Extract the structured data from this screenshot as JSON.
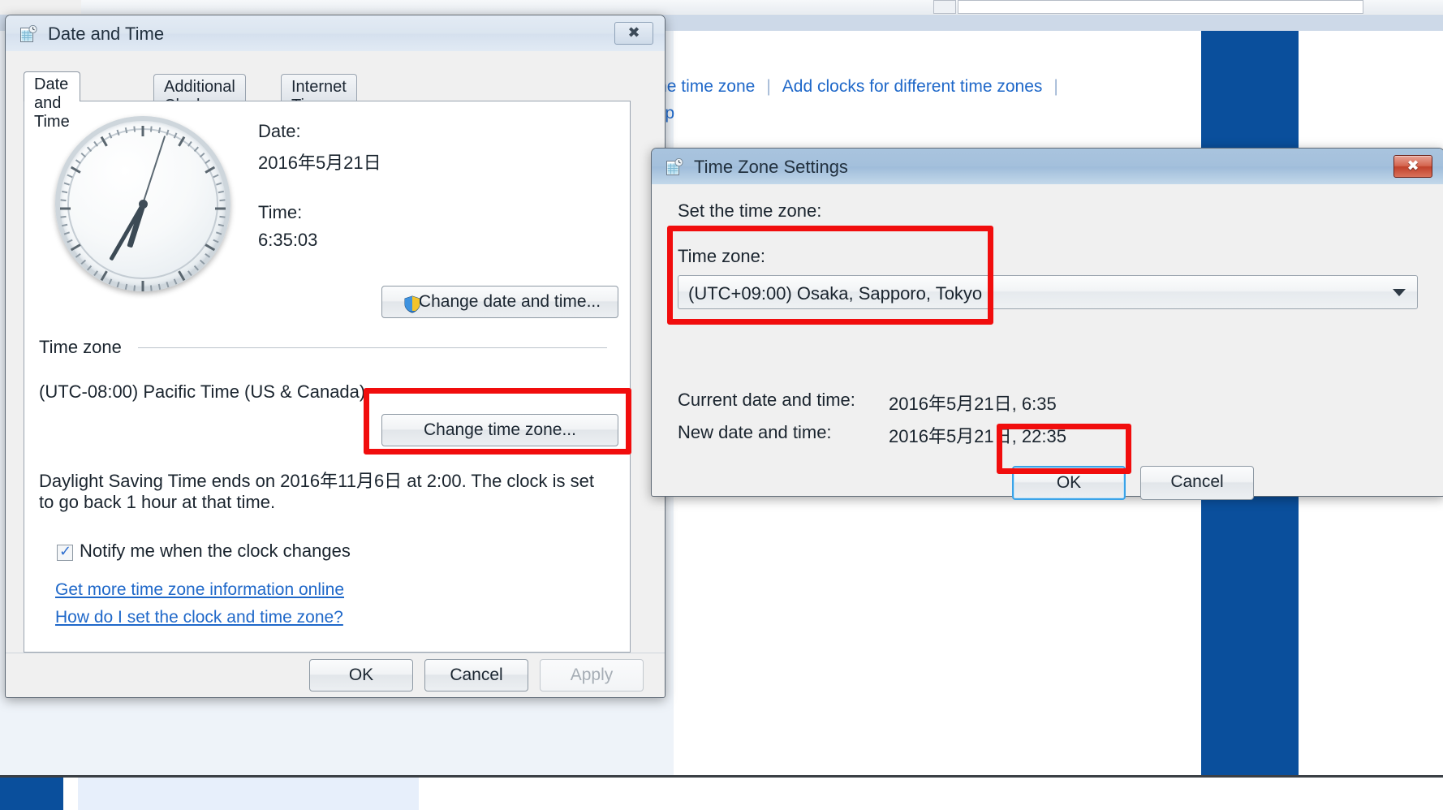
{
  "background_window": {
    "links_row1": [
      {
        "label": "hange the time zone"
      },
      {
        "label": "Add clocks for different time zones"
      }
    ],
    "separator": "|",
    "links_row2": "e desktop"
  },
  "date_time_dialog": {
    "title": "Date and Time",
    "title_icon": "calendar-clock-icon",
    "close_label": "✖",
    "tabs": [
      {
        "label": "Date and Time",
        "selected": true
      },
      {
        "label": "Additional Clocks",
        "selected": false
      },
      {
        "label": "Internet Time",
        "selected": false
      }
    ],
    "clock": {
      "hour": 6,
      "minute": 35,
      "second": 3
    },
    "date_label": "Date:",
    "date_value": "2016年5月21日",
    "time_label": "Time:",
    "time_value": "6:35:03",
    "change_date_time_button": "Change date and time...",
    "time_zone_group_label": "Time zone",
    "time_zone_value": "(UTC-08:00) Pacific Time (US & Canada)",
    "change_time_zone_button": "Change time zone...",
    "dst_text": "Daylight Saving Time ends on 2016年11月6日 at 2:00. The clock is set to go back 1 hour at that time.",
    "notify_checkbox_label": "Notify me when the clock changes",
    "notify_checkbox_checked": true,
    "link_more_info": "Get more time zone information online",
    "link_how_do_i": "How do I set the clock and time zone?",
    "buttons": {
      "ok": "OK",
      "cancel": "Cancel",
      "apply": "Apply",
      "apply_disabled": true
    }
  },
  "time_zone_settings_dialog": {
    "title": "Time Zone Settings",
    "title_icon": "calendar-clock-icon",
    "close_label": "✖",
    "set_time_zone_label": "Set the time zone:",
    "time_zone_label": "Time zone:",
    "time_zone_selected": "(UTC+09:00) Osaka, Sapporo, Tokyo",
    "current_date_time_label": "Current date and time:",
    "current_date_time_value": "2016年5月21日, 6:35",
    "new_date_time_label": "New date and time:",
    "new_date_time_value": "2016年5月21日, 22:35",
    "buttons": {
      "ok": "OK",
      "cancel": "Cancel"
    }
  },
  "annotations": {
    "highlight_color": "#f10d0d",
    "boxes": [
      {
        "name": "time-zone-combo-highlight"
      },
      {
        "name": "change-time-zone-button-highlight"
      },
      {
        "name": "ok-button-highlight"
      }
    ]
  }
}
